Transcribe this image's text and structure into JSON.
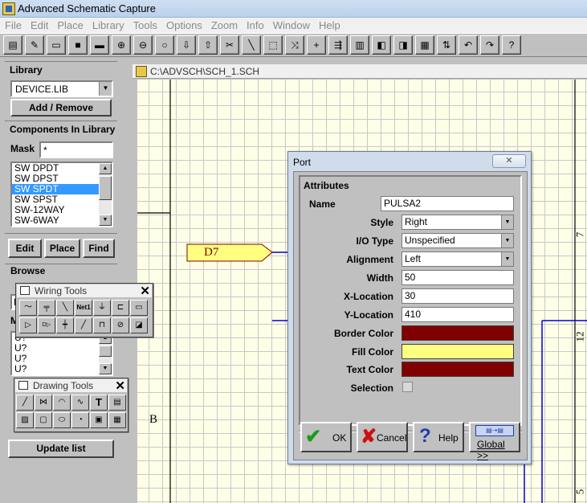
{
  "window": {
    "title": "Advanced Schematic Capture"
  },
  "menu": [
    "File",
    "Edit",
    "Place",
    "Library",
    "Tools",
    "Options",
    "Zoom",
    "Info",
    "Window",
    "Help"
  ],
  "toolbar": {
    "icons": [
      "open-folder-icon",
      "edit-icon",
      "open-file-icon",
      "save-icon",
      "print-icon",
      "zoom-in-icon",
      "zoom-out-icon",
      "zoom-area-icon",
      "move-down-icon",
      "move-up-icon",
      "cut-wire-icon",
      "pencil-icon",
      "select-icon",
      "mirror-icon",
      "cross-icon",
      "bus-icon",
      "component-icon",
      "port-icon",
      "power-port-icon",
      "netlist-icon",
      "swap-icon",
      "undo-icon",
      "redo-icon",
      "help-icon"
    ],
    "help_label": "?"
  },
  "library": {
    "label": "Library",
    "selected": "DEVICE.LIB",
    "add_remove": "Add / Remove",
    "components_label": "Components In Library",
    "mask_label": "Mask",
    "mask_value": "*",
    "components": [
      "SW DPDT",
      "SW DPST",
      "SW SPDT",
      "SW SPST",
      "SW-12WAY",
      "SW-6WAY"
    ],
    "selected_component": "SW SPDT",
    "edit": "Edit",
    "place": "Place",
    "find": "Find"
  },
  "browse": {
    "label": "Browse",
    "m_label": "M",
    "p_label": "P",
    "items": [
      "U?",
      "U?",
      "U?",
      "U?"
    ],
    "update_list": "Update list"
  },
  "document": {
    "path": "C:\\ADVSCH\\SCH_1.SCH"
  },
  "schematic": {
    "port_label": "D7",
    "letter_b": "B",
    "right_num_1": "7",
    "right_num_2": "12",
    "right_num_3": "5"
  },
  "wiring_tools": {
    "title": "Wiring Tools",
    "net_label": "Net1",
    "close": "✕"
  },
  "drawing_tools": {
    "title": "Drawing Tools",
    "close": "✕",
    "text_tool": "T"
  },
  "port_dialog": {
    "title": "Port",
    "close": "✕",
    "group": "Attributes",
    "name_label": "Name",
    "name_value": "PULSA2",
    "style_label": "Style",
    "style_value": "Right",
    "io_label": "I/O Type",
    "io_value": "Unspecified",
    "align_label": "Alignment",
    "align_value": "Left",
    "width_label": "Width",
    "width_value": "50",
    "x_label": "X-Location",
    "x_value": "30",
    "y_label": "Y-Location",
    "y_value": "410",
    "border_label": "Border Color",
    "border_color": "#800000",
    "fill_label": "Fill Color",
    "fill_color": "#ffff80",
    "text_label": "Text Color",
    "text_color": "#800000",
    "selection_label": "Selection",
    "ok": "OK",
    "cancel": "Cancel",
    "help": "Help",
    "global": "Global >>"
  }
}
